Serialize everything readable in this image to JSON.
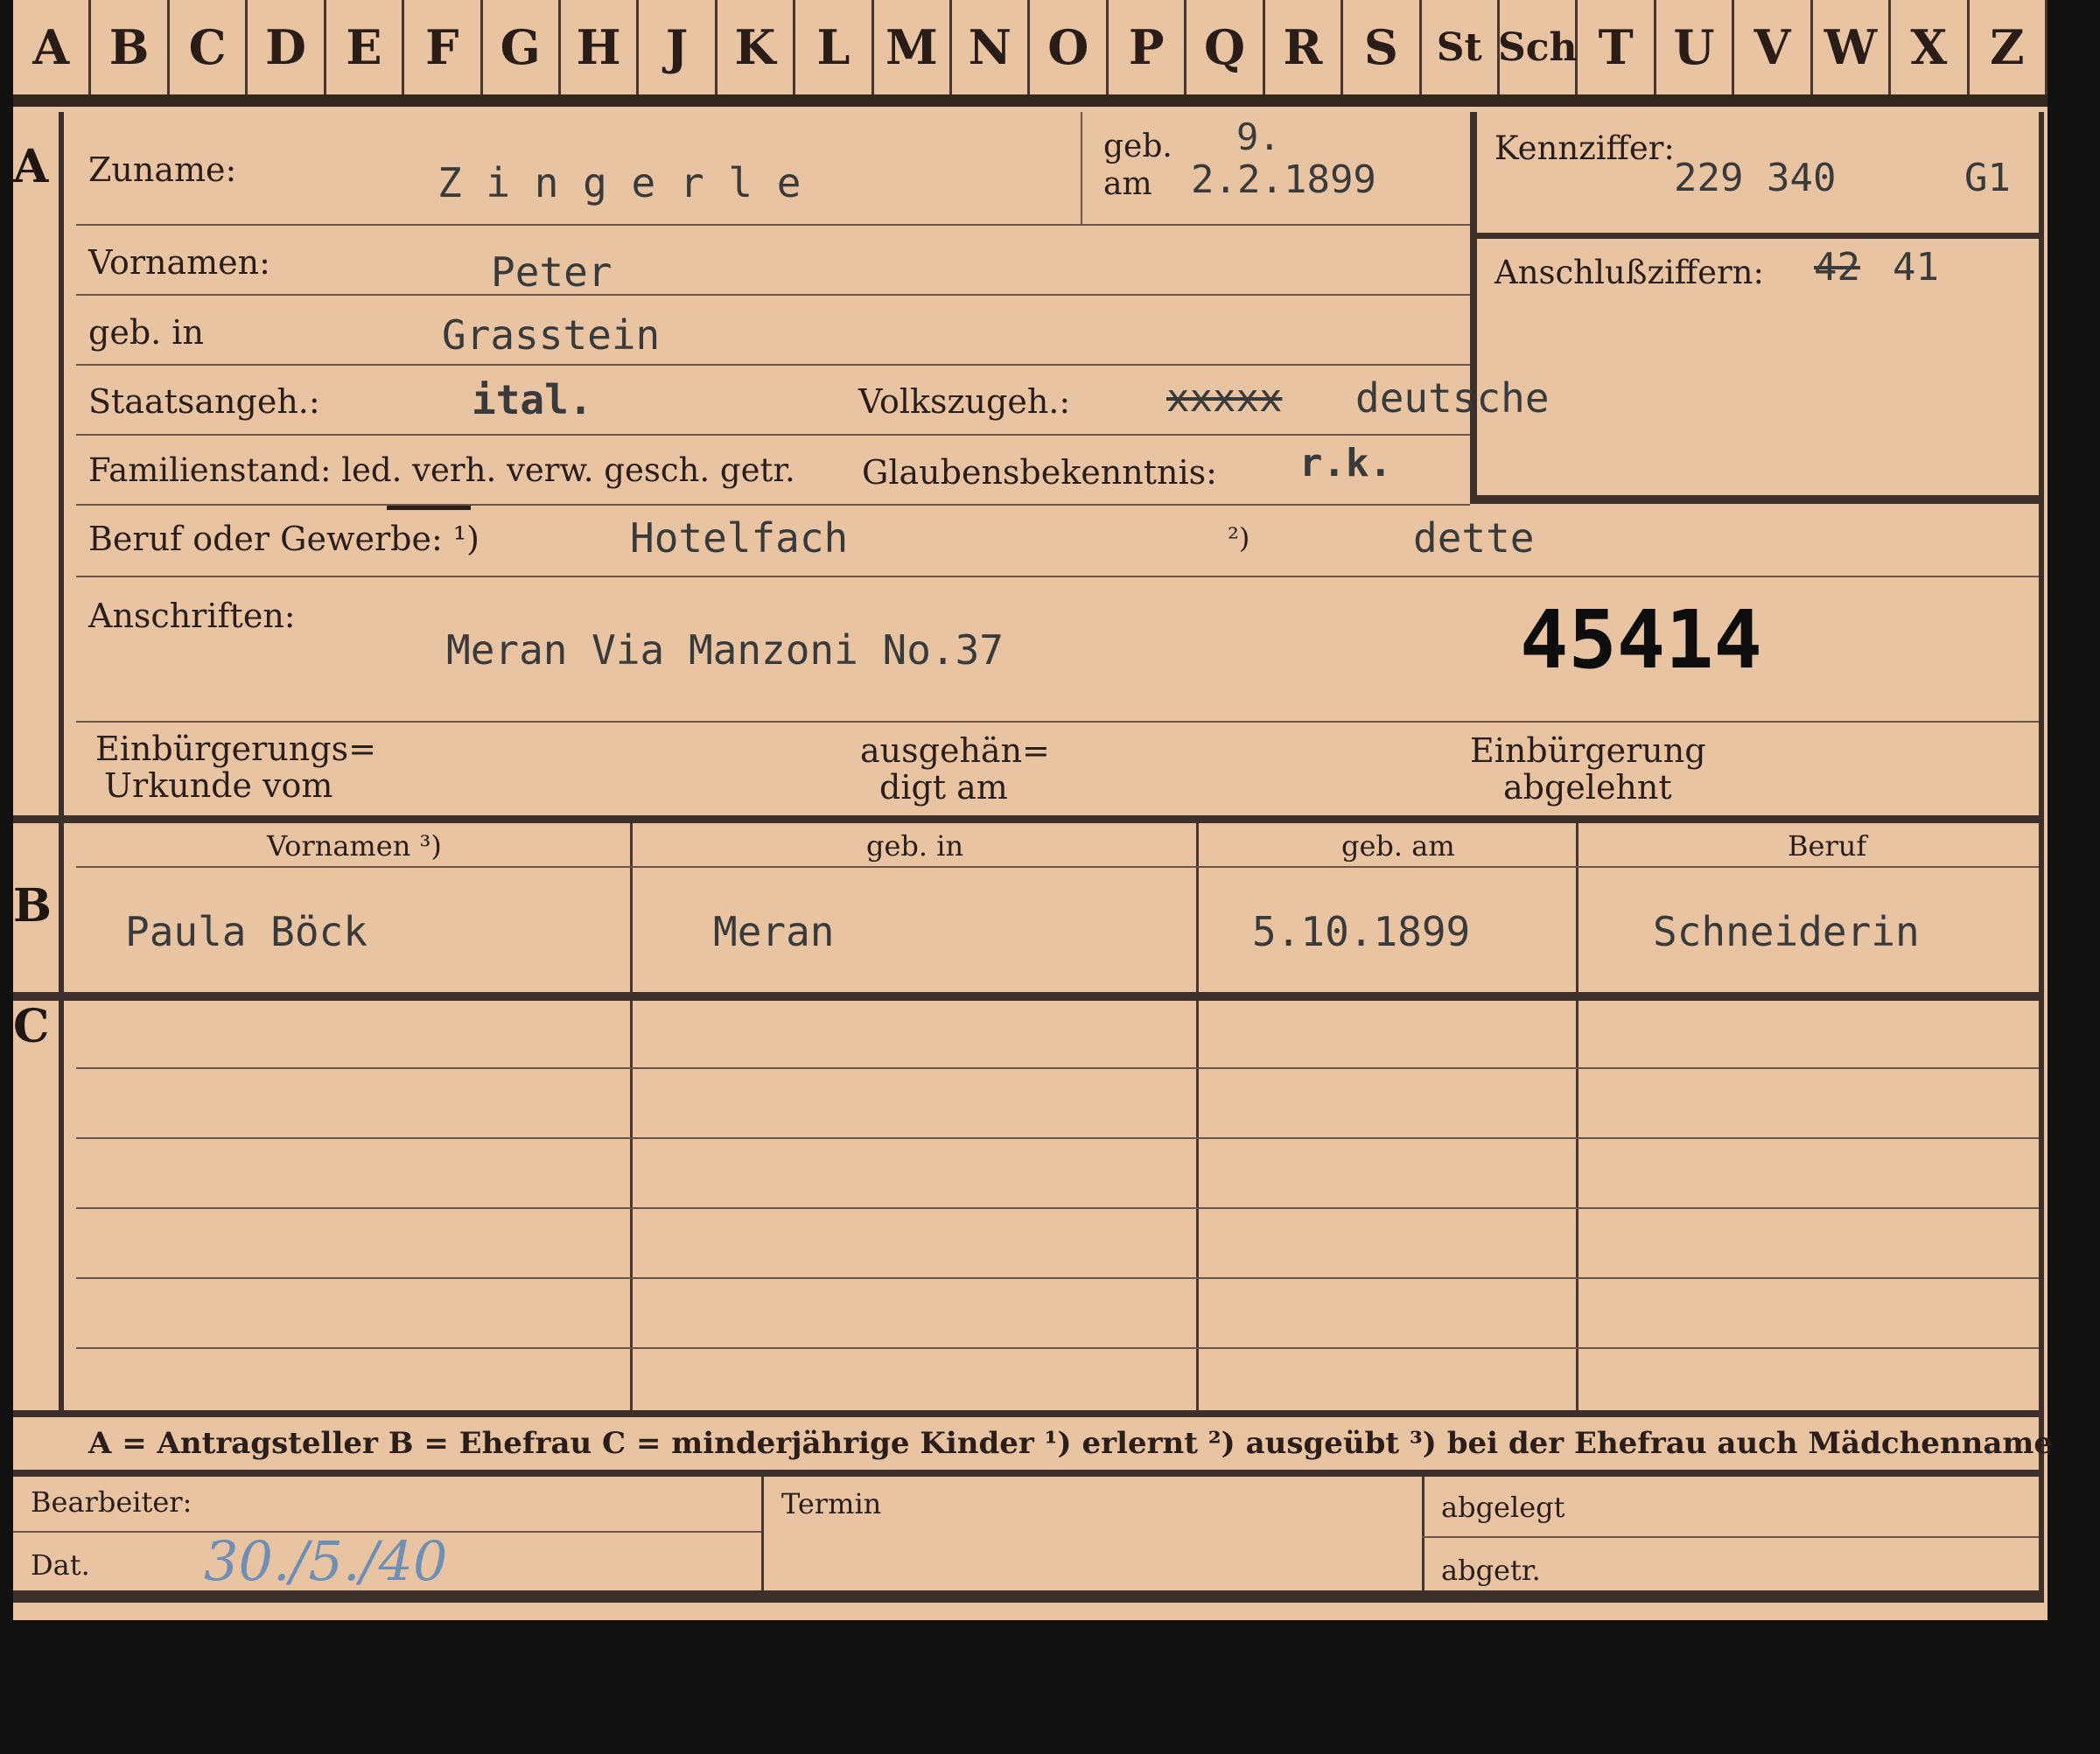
{
  "tabs": [
    "A",
    "B",
    "C",
    "D",
    "E",
    "F",
    "G",
    "H",
    "J",
    "K",
    "L",
    "M",
    "N",
    "O",
    "P",
    "Q",
    "R",
    "S",
    "St",
    "Sch",
    "T",
    "U",
    "V",
    "W",
    "X",
    "Z"
  ],
  "section_labels": {
    "a": "A",
    "b": "B",
    "c": "C"
  },
  "applicant": {
    "zuname_label": "Zuname:",
    "zuname_value": "Z i n g e r l e",
    "geb_am_label_1": "geb.",
    "geb_am_label_2": "am",
    "birth_day_correction": "9.",
    "birth_date": "2.2.1899",
    "vornamen_label": "Vornamen:",
    "vornamen_value": "Peter",
    "geb_in_label": "geb. in",
    "geb_in_value": "Grasstein",
    "staatsangeh_label": "Staatsangeh.:",
    "staatsangeh_value": "ital.",
    "volkszugeh_label": "Volkszugeh.:",
    "volkszugeh_struck": "xxxxx",
    "volkszugeh_value": "deutsche",
    "familienstand_label": "Familienstand: led. verh. verw. gesch. getr.",
    "glaubens_label": "Glaubensbekenntnis:",
    "glaubens_value": "r.k.",
    "beruf_label": "Beruf oder Gewerbe: ¹)",
    "beruf_value": "Hotelfach",
    "beruf_note": "²)",
    "beruf_value2": "dette",
    "anschriften_label": "Anschriften:",
    "anschriften_value": "Meran Via Manzoni No.37",
    "stamp_number": "45414",
    "einbuergerung_label_1": "Einbürgerungs=",
    "einbuergerung_label_2": "Urkunde vom",
    "ausgehaen_label_1": "ausgehän=",
    "ausgehaen_label_2": "digt am",
    "abgelehnt_label_1": "Einbürgerung",
    "abgelehnt_label_2": "abgelehnt"
  },
  "kennziffer": {
    "label": "Kennziffer:",
    "value": "229 340",
    "suffix": "G1",
    "anschluss_label": "Anschlußziffern:",
    "anschluss_struck": "42",
    "anschluss_value": "41"
  },
  "spouse_table": {
    "headers": [
      "Vornamen ³)",
      "geb. in",
      "geb. am",
      "Beruf"
    ],
    "row": [
      "Paula Böck",
      "Meran",
      "5.10.1899",
      "Schneiderin"
    ]
  },
  "legend": "A = Antragsteller   B = Ehefrau   C = minderjährige Kinder  ¹) erlernt  ²) ausgeübt  ³) bei der Ehefrau auch Mädchenname",
  "footer": {
    "bearbeiter_label": "Bearbeiter:",
    "dat_label": "Dat.",
    "dat_value": "30./5./40",
    "termin_label": "Termin",
    "abgelegt_label": "abgelegt",
    "abgetr_label": "abgetr."
  },
  "colors": {
    "card": "#e8c4a3",
    "ink": "#2b1d18",
    "rule": "#3d2f2a",
    "handwriting": "#6f8fb5"
  }
}
